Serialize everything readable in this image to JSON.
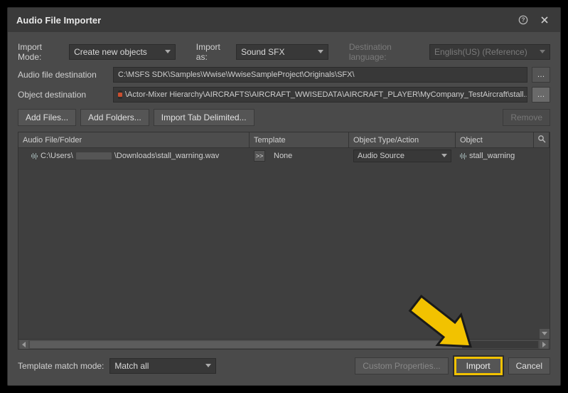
{
  "title": "Audio File Importer",
  "topRow": {
    "importModeLabel": "Import Mode:",
    "importModeValue": "Create new objects",
    "importAsLabel": "Import as:",
    "importAsValue": "Sound SFX",
    "destLangLabel": "Destination language:",
    "destLangValue": "English(US) (Reference)"
  },
  "dest": {
    "audioFileLabel": "Audio file destination",
    "audioFilePath": "C:\\MSFS SDK\\Samples\\Wwise\\WwiseSampleProject\\Originals\\SFX\\",
    "objectLabel": "Object destination",
    "objectPath": "\\Actor-Mixer Hierarchy\\AIRCRAFTS\\AIRCRAFT_WWISEDATA\\AIRCRAFT_PLAYER\\MyCompany_TestAircraft\\stall..."
  },
  "buttons": {
    "addFiles": "Add Files...",
    "addFolders": "Add Folders...",
    "importTab": "Import Tab Delimited...",
    "remove": "Remove"
  },
  "table": {
    "headers": {
      "file": "Audio File/Folder",
      "template": "Template",
      "type": "Object Type/Action",
      "object": "Object"
    },
    "rows": [
      {
        "filePrefix": "C:\\Users\\",
        "fileSuffix": "\\Downloads\\stall_warning.wav",
        "gt": ">>",
        "template": "None",
        "type": "Audio Source",
        "object": "stall_warning"
      }
    ]
  },
  "footer": {
    "tplMatchLabel": "Template match mode:",
    "tplMatchValue": "Match all",
    "customProps": "Custom Properties...",
    "import": "Import",
    "cancel": "Cancel"
  }
}
